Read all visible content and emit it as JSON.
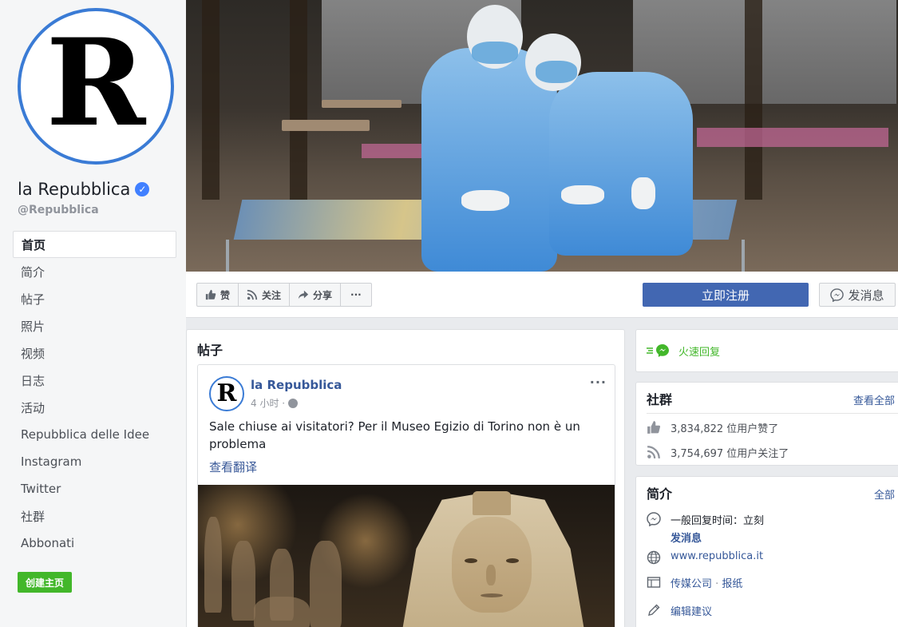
{
  "profile": {
    "avatar_letter": "R",
    "name": "la Repubblica",
    "verified_mark": "✓",
    "handle": "@Repubblica"
  },
  "sidebar": {
    "items": [
      {
        "label": "首页"
      },
      {
        "label": "简介"
      },
      {
        "label": "帖子"
      },
      {
        "label": "照片"
      },
      {
        "label": "视频"
      },
      {
        "label": "日志"
      },
      {
        "label": "活动"
      },
      {
        "label": "Repubblica delle Idee"
      },
      {
        "label": "Instagram"
      },
      {
        "label": "Twitter"
      },
      {
        "label": "社群"
      },
      {
        "label": "Abbonati"
      }
    ],
    "create_page": "创建主页"
  },
  "actions": {
    "like": "赞",
    "follow": "关注",
    "share": "分享",
    "more": "···",
    "signup": "立即注册",
    "message": "发消息"
  },
  "posts": {
    "section_title": "帖子",
    "post": {
      "avatar_letter": "R",
      "author": "la Repubblica",
      "time": "4 小时 ·",
      "more": "···",
      "text": "Sale chiuse ai visitatori? Per il Museo Egizio di Torino non è un problema",
      "see_translation": "查看翻译"
    }
  },
  "right": {
    "fast_reply": "火速回复",
    "community": {
      "title": "社群",
      "see_all": "查看全部",
      "likes": "3,834,822 位用户赞了",
      "follows": "3,754,697 位用户关注了"
    },
    "intro": {
      "title": "简介",
      "see_all": "全部",
      "response_time": "一般回复时间：立刻",
      "send_message": "发消息",
      "website": "www.repubblica.it",
      "category_a": "传媒公司",
      "category_sep": " · ",
      "category_b": "报纸",
      "suggest_edit": "编辑建议"
    }
  },
  "colors": {
    "primary_blue": "#4267b2",
    "link_blue": "#365899",
    "green": "#42b72a",
    "ring_blue": "#3a7bd5"
  }
}
